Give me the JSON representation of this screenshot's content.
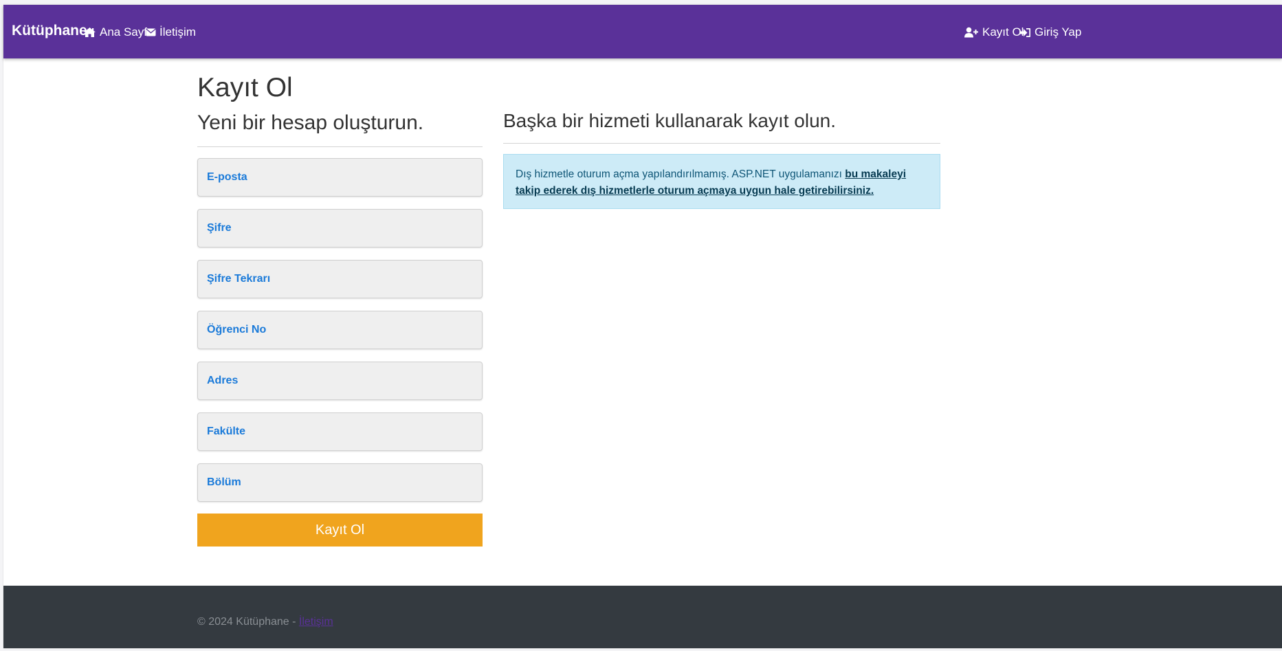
{
  "navbar": {
    "brand": "Kütüphane",
    "background": "#5a3199",
    "left_links": [
      {
        "label": "Ana Sayfa",
        "icon": "home-icon"
      },
      {
        "label": "İletişim",
        "icon": "envelope-icon"
      }
    ],
    "right_links": [
      {
        "label": "Kayıt Ol",
        "icon": "user-plus-icon"
      },
      {
        "label": "Giriş Yap",
        "icon": "sign-in-icon"
      }
    ]
  },
  "page": {
    "title": "Kayıt Ol",
    "subtitle": "Yeni bir hesap oluşturun.",
    "external_title": "Başka bir hizmeti kullanarak kayıt olun."
  },
  "form": {
    "fields": [
      {
        "label": "E-posta"
      },
      {
        "label": "Şifre"
      },
      {
        "label": "Şifre Tekrarı"
      },
      {
        "label": "Öğrenci No"
      },
      {
        "label": "Adres"
      },
      {
        "label": "Fakülte"
      },
      {
        "label": "Bölüm"
      }
    ],
    "label_color": "#1a7ad9",
    "submit_label": "Kayıt Ol",
    "submit_color": "#f0a41e"
  },
  "alert": {
    "text": "Dış hizmetle oturum açma yapılandırılmamış. ASP.NET uygulamanızı ",
    "link_text": "bu makaleyi takip ederek dış hizmetlerle oturum açmaya uygun hale getirebilirsiniz.",
    "background": "#cdebf7"
  },
  "footer": {
    "copyright": "© 2024 Kütüphane - ",
    "link": "İletişim",
    "background": "#343a40"
  }
}
